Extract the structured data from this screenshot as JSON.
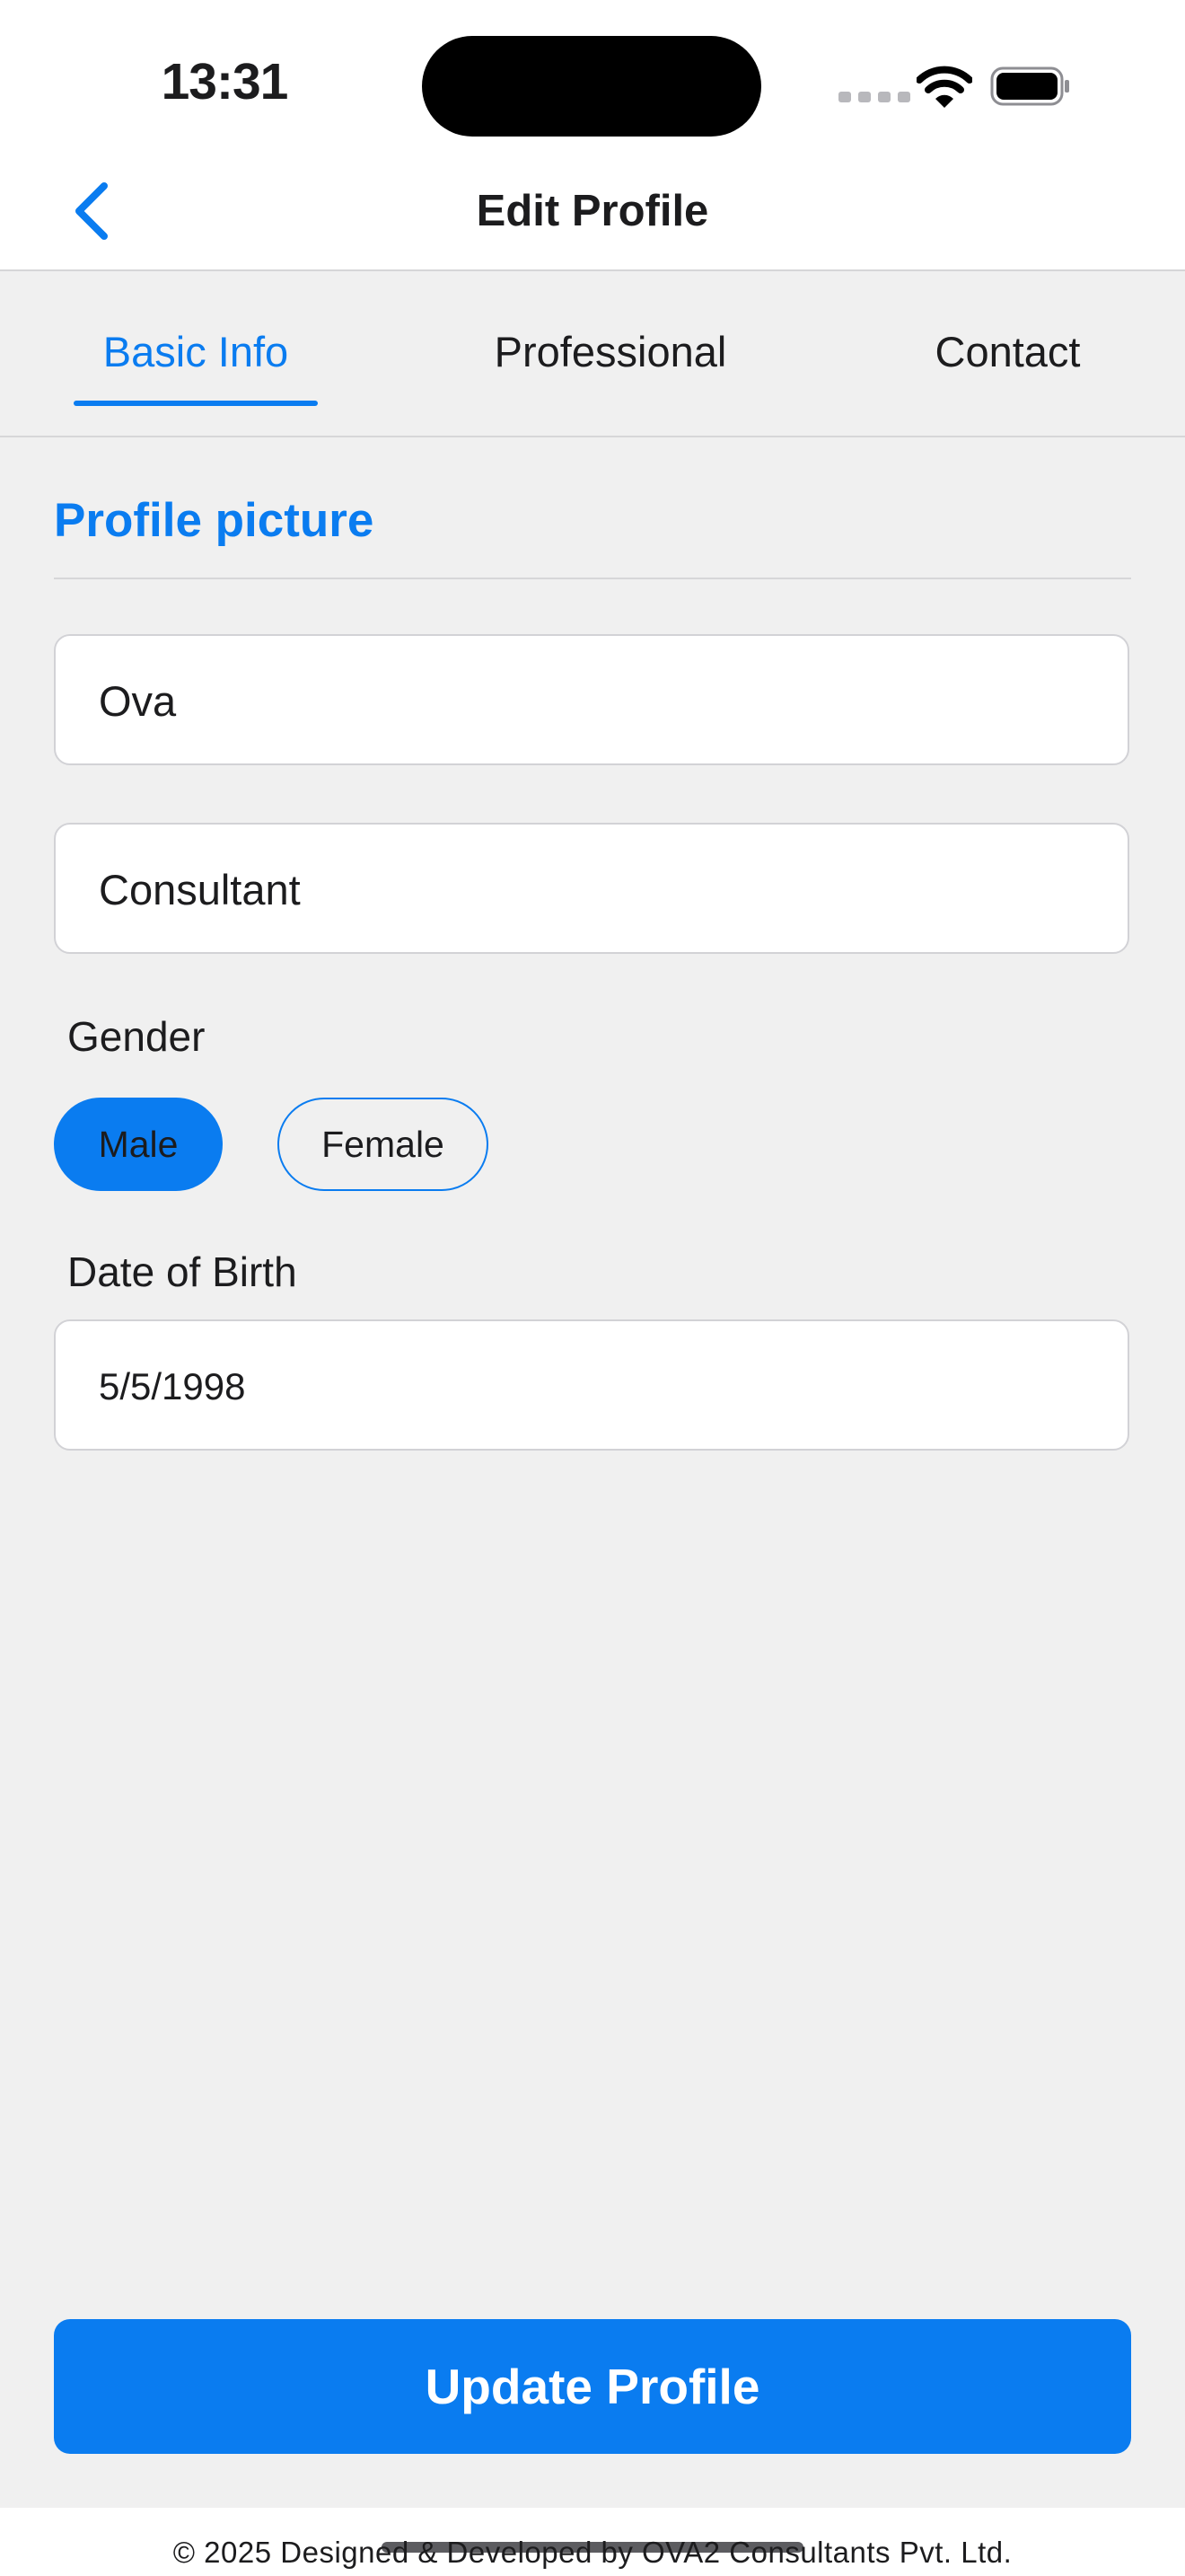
{
  "status_bar": {
    "time": "13:31"
  },
  "nav": {
    "title": "Edit Profile",
    "back_icon": "chevron-left-icon"
  },
  "tabs": [
    {
      "label": "Basic Info",
      "active": true
    },
    {
      "label": "Professional",
      "active": false
    },
    {
      "label": "Contact",
      "active": false
    }
  ],
  "profile_picture": {
    "label": "Profile picture"
  },
  "form": {
    "name_value": "Ova",
    "title_value": "Consultant",
    "gender_label": "Gender",
    "gender_options": [
      {
        "label": "Male",
        "selected": true
      },
      {
        "label": "Female",
        "selected": false
      }
    ],
    "dob_label": "Date of Birth",
    "dob_value": "5/5/1998"
  },
  "actions": {
    "update_label": "Update Profile"
  },
  "footer": {
    "text": "© 2025 Designed & Developed by OVA2 Consultants Pvt. Ltd."
  },
  "colors": {
    "accent": "#0a7cf0",
    "background": "#f0f0f0",
    "surface": "#ffffff"
  }
}
